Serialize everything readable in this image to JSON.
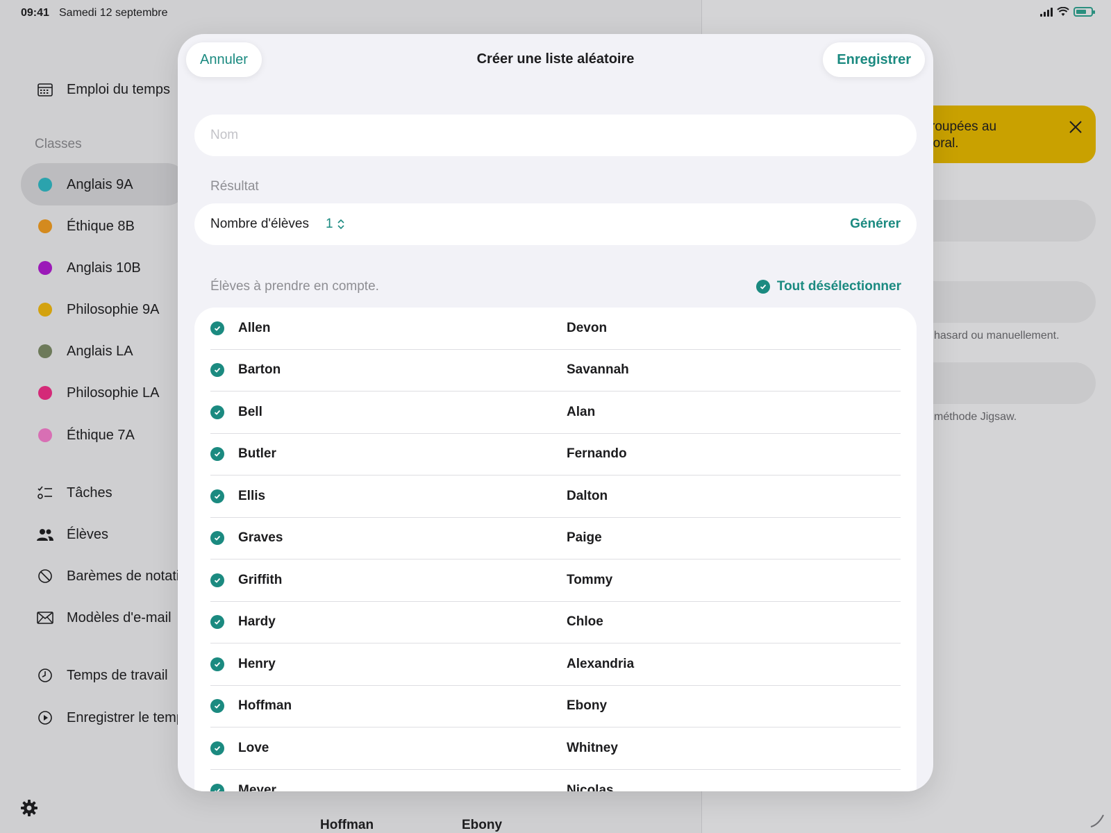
{
  "status_bar": {
    "time": "09:41",
    "date": "Samedi 12 septembre"
  },
  "colors": {
    "accent": "#1b8a80",
    "banner": "#c9a100"
  },
  "sidebar": {
    "schedule_label": "Emploi du temps",
    "classes_heading": "Classes",
    "classes": [
      {
        "label": "Anglais 9A",
        "color": "#2ba3ad"
      },
      {
        "label": "Éthique 8B",
        "color": "#d48a1e"
      },
      {
        "label": "Anglais 10B",
        "color": "#9b19b8"
      },
      {
        "label": "Philosophie 9A",
        "color": "#d3a20f"
      },
      {
        "label": "Anglais LA",
        "color": "#6d7a5a"
      },
      {
        "label": "Philosophie LA",
        "color": "#d42a78"
      },
      {
        "label": "Éthique 7A",
        "color": "#d86fb4"
      }
    ],
    "tools": [
      {
        "label": "Tâches",
        "icon": "tasks-icon"
      },
      {
        "label": "Élèves",
        "icon": "students-icon"
      },
      {
        "label": "Barèmes de notati",
        "icon": "grading-icon"
      },
      {
        "label": "Modèles d'e-mail",
        "icon": "mail-icon"
      }
    ],
    "time_items": [
      {
        "label": "Temps de travail",
        "icon": "clock-icon"
      },
      {
        "label": "Enregistrer le temp",
        "icon": "play-circle-icon"
      }
    ]
  },
  "background": {
    "banner_text": "roupées au\n'oral.",
    "hint_1": "hasard ou manuellement.",
    "hint_2": "méthode Jigsaw.",
    "bottom_last": "Hoffman",
    "bottom_first": "Ebony"
  },
  "modal": {
    "cancel_label": "Annuler",
    "title": "Créer une liste aléatoire",
    "save_label": "Enregistrer",
    "name_placeholder": "Nom",
    "result_heading": "Résultat",
    "count_label": "Nombre d'élèves",
    "count_value": "1",
    "generate_label": "Générer",
    "students_heading": "Élèves à prendre en compte.",
    "deselect_label": "Tout désélectionner",
    "students": [
      {
        "last": "Allen",
        "first": "Devon"
      },
      {
        "last": "Barton",
        "first": "Savannah"
      },
      {
        "last": "Bell",
        "first": "Alan"
      },
      {
        "last": "Butler",
        "first": "Fernando"
      },
      {
        "last": "Ellis",
        "first": "Dalton"
      },
      {
        "last": "Graves",
        "first": "Paige"
      },
      {
        "last": "Griffith",
        "first": "Tommy"
      },
      {
        "last": "Hardy",
        "first": "Chloe"
      },
      {
        "last": "Henry",
        "first": "Alexandria"
      },
      {
        "last": "Hoffman",
        "first": "Ebony"
      },
      {
        "last": "Love",
        "first": "Whitney"
      },
      {
        "last": "Meyer",
        "first": "Nicolas"
      }
    ]
  }
}
